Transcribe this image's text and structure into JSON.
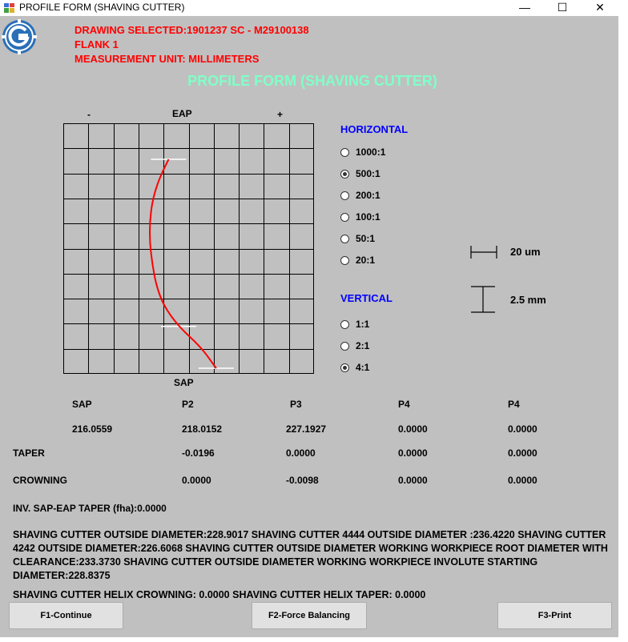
{
  "window": {
    "title": "PROFILE FORM (SHAVING CUTTER)",
    "minimize_glyph": "—",
    "maximize_glyph": "☐",
    "close_glyph": "✕"
  },
  "header": {
    "drawing": "DRAWING SELECTED:1901237 SC - M29100138",
    "flank": "FLANK 1",
    "unit": "MEASUREMENT UNIT: MILLIMETERS",
    "main_title": "PROFILE FORM (SHAVING CUTTER)"
  },
  "chart_data": {
    "type": "line",
    "top_label": "EAP",
    "bottom_label": "SAP",
    "minus_label": "-",
    "plus_label": "+",
    "grid_cols": 10,
    "grid_rows": 10,
    "grid": true,
    "curve_color": "#ff0000",
    "series": [
      {
        "values": [
          -0.8,
          -1.2,
          -1.45,
          -1.55,
          -1.55,
          -1.45,
          -1.3,
          -1.0,
          -0.4,
          0.5,
          1.1
        ]
      }
    ]
  },
  "horizontal": {
    "label": "HORIZONTAL",
    "options": [
      "1000:1",
      "500:1",
      "200:1",
      "100:1",
      "50:1",
      "20:1"
    ],
    "selected": "500:1"
  },
  "vertical": {
    "label": "VERTICAL",
    "options": [
      "1:1",
      "2:1",
      "4:1"
    ],
    "selected": "4:1"
  },
  "scale": {
    "horizontal_value": "20 um",
    "vertical_value": "2.5 mm"
  },
  "table": {
    "headers": [
      "SAP",
      "P2",
      "P3",
      "P4",
      "P4"
    ],
    "values": [
      "216.0559",
      "218.0152",
      "227.1927",
      "0.0000",
      "0.0000"
    ],
    "taper_label": "TAPER",
    "taper": [
      "-0.0196",
      "0.0000",
      "0.0000",
      "0.0000"
    ],
    "crowning_label": "CROWNING",
    "crowning": [
      "0.0000",
      "-0.0098",
      "0.0000",
      "0.0000"
    ]
  },
  "inv_taper": "INV. SAP-EAP TAPER (fha):0.0000",
  "diameters": "SHAVING CUTTER OUTSIDE DIAMETER:228.9017 SHAVING CUTTER 4444 OUTSIDE DIAMETER :236.4220 SHAVING CUTTER 4242 OUTSIDE DIAMETER:226.6068 SHAVING CUTTER OUTSIDE DIAMETER WORKING WORKPIECE ROOT DIAMETER WITH CLEARANCE:233.3730 SHAVING CUTTER OUTSIDE DIAMETER WORKING WORKPIECE INVOLUTE STARTING DIAMETER:228.8375",
  "helix": "SHAVING CUTTER HELIX CROWNING: 0.0000 SHAVING CUTTER HELIX TAPER: 0.0000",
  "buttons": {
    "continue": "F1-Continue",
    "force_balancing": "F2-Force Balancing",
    "print": "F3-Print"
  }
}
